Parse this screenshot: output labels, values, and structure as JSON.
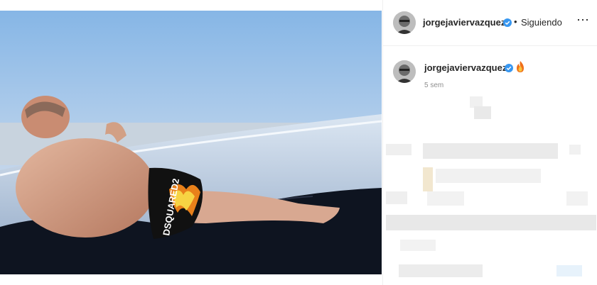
{
  "post": {
    "author": "jorgejaviervazquez",
    "follow_status": "Siguiendo",
    "separator": "•",
    "more_icon": "more-horizontal-icon",
    "photo_print_text": "DSQUARED2"
  },
  "caption": {
    "author": "jorgejaviervazquez",
    "emoji_icon": "fire-emoji-icon",
    "timestamp": "5 sem"
  },
  "colors": {
    "verified": "#3897f0",
    "sky_top": "#86b6e6",
    "sky_bottom": "#f1e5e4",
    "sea": "#b7c9d8",
    "fabric": "#0e1420",
    "skin": "#d79f84"
  }
}
